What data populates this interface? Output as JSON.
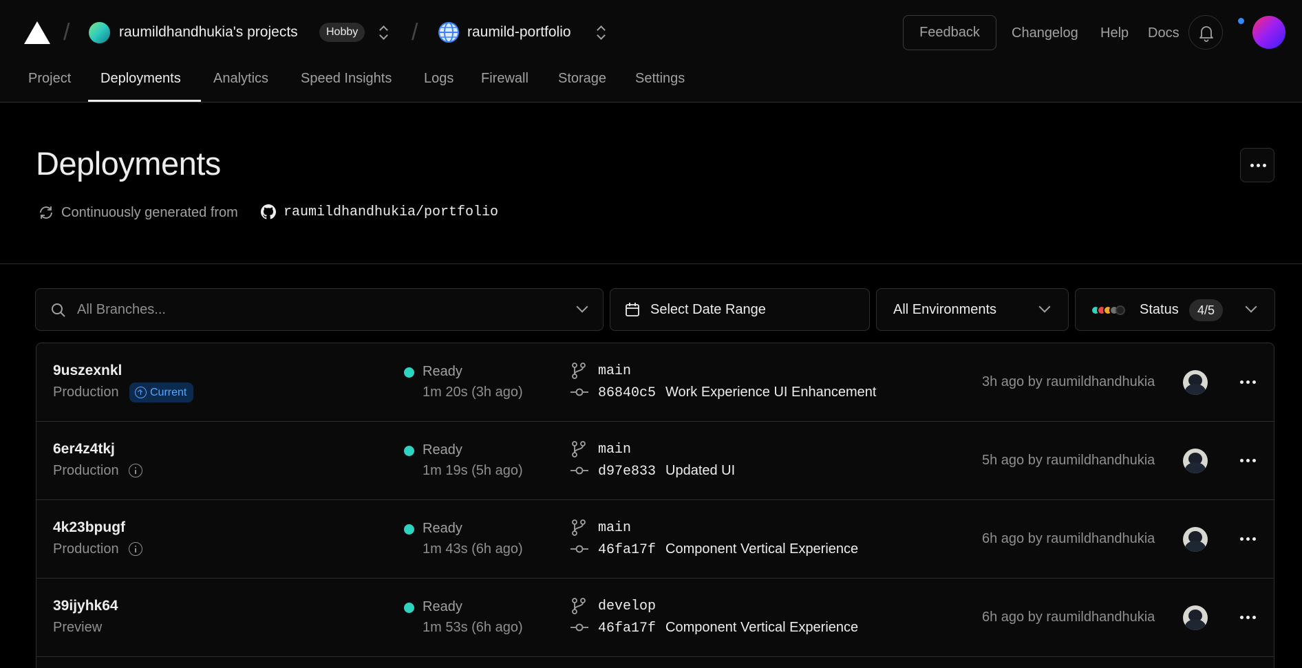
{
  "header": {
    "team_name": "raumildhandhukia's projects",
    "plan": "Hobby",
    "project_name": "raumild-portfolio",
    "feedback_label": "Feedback",
    "links": [
      "Changelog",
      "Help",
      "Docs"
    ]
  },
  "tabs": [
    "Project",
    "Deployments",
    "Analytics",
    "Speed Insights",
    "Logs",
    "Firewall",
    "Storage",
    "Settings"
  ],
  "active_tab": "Deployments",
  "page": {
    "title": "Deployments",
    "source_text": "Continuously generated from",
    "repo": "raumildhandhukia/portfolio"
  },
  "filters": {
    "branch_placeholder": "All Branches...",
    "date_range_label": "Select Date Range",
    "environment_label": "All Environments",
    "status_label": "Status",
    "status_count": "4/5",
    "status_colors": [
      "#2dd4bf",
      "#e5484d",
      "#f5a524",
      "#707070",
      "#1f1f1f"
    ]
  },
  "deployments": [
    {
      "id": "9uszexnkl",
      "environment": "Production",
      "badge": "Current",
      "status": "Ready",
      "duration": "1m 20s (3h ago)",
      "branch": "main",
      "commit_sha": "86840c5",
      "commit_message": "Work Experience UI Enhancement",
      "created": "3h ago by raumildhandhukia"
    },
    {
      "id": "6er4z4tkj",
      "environment": "Production",
      "badge": "",
      "status": "Ready",
      "duration": "1m 19s (5h ago)",
      "branch": "main",
      "commit_sha": "d97e833",
      "commit_message": "Updated UI",
      "created": "5h ago by raumildhandhukia"
    },
    {
      "id": "4k23bpugf",
      "environment": "Production",
      "badge": "",
      "status": "Ready",
      "duration": "1m 43s (6h ago)",
      "branch": "main",
      "commit_sha": "46fa17f",
      "commit_message": "Component Vertical Experience",
      "created": "6h ago by raumildhandhukia"
    },
    {
      "id": "39ijyhk64",
      "environment": "Preview",
      "badge": "",
      "status": "Ready",
      "duration": "1m 53s (6h ago)",
      "branch": "develop",
      "commit_sha": "46fa17f",
      "commit_message": "Component Vertical Experience",
      "created": "6h ago by raumildhandhukia"
    }
  ],
  "colors": {
    "background": "#000000",
    "surface": "#0a0a0a",
    "border": "#2e2e2e",
    "ready": "#2dd4bf",
    "current_badge_bg": "#0b2a4e",
    "current_badge_fg": "#52a8ff",
    "notification": "#2f8bff"
  }
}
